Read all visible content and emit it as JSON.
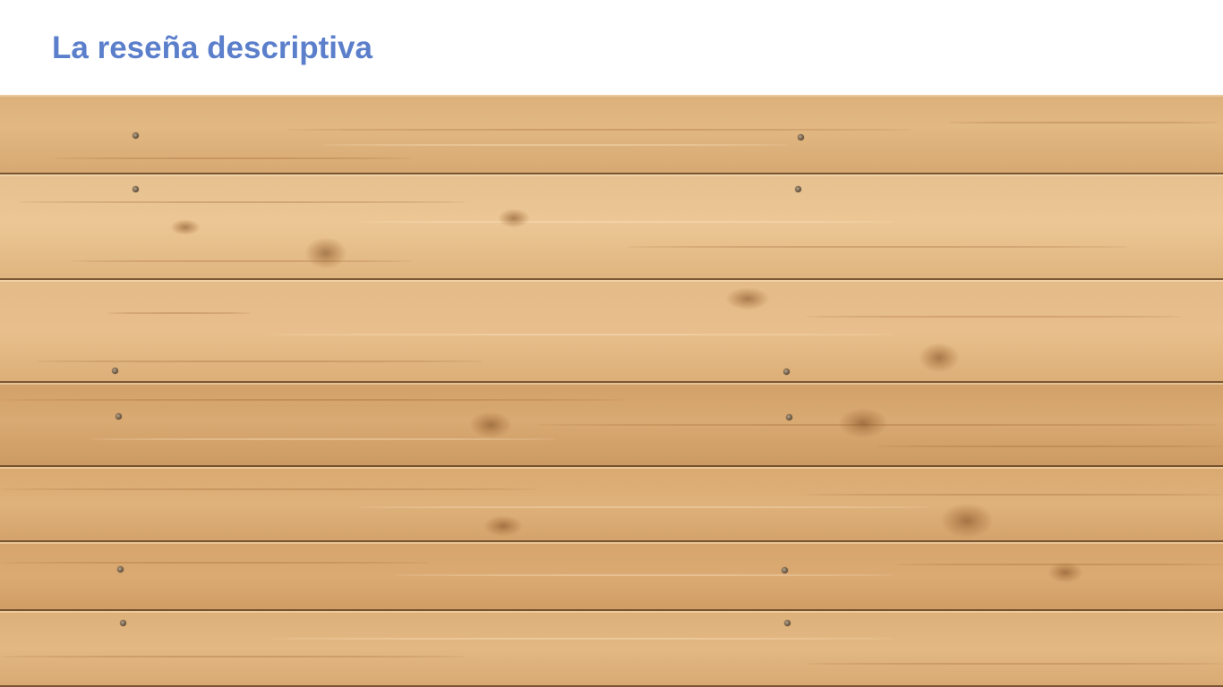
{
  "slide": {
    "title": "La reseña descriptiva"
  },
  "colors": {
    "title": "#5b7fcb",
    "wood": "#d9ab74"
  }
}
